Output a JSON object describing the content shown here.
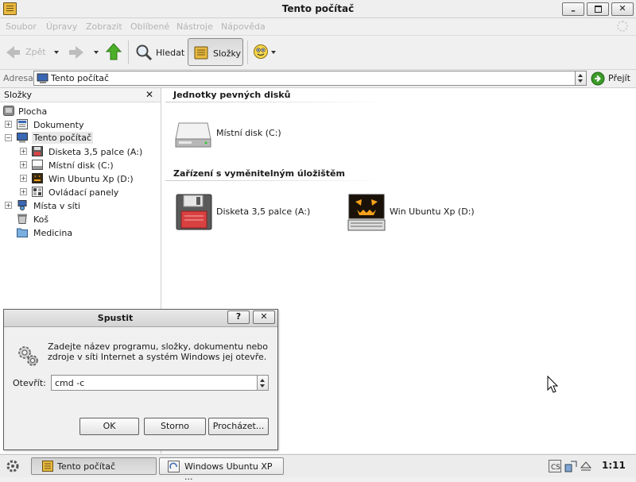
{
  "window": {
    "title": "Tento počítač"
  },
  "menu": {
    "items": [
      "Soubor",
      "Úpravy",
      "Zobrazit",
      "Oblíbené",
      "Nástroje",
      "Nápověda"
    ]
  },
  "toolbar": {
    "back_label": "Zpět",
    "search_label": "Hledat",
    "folders_label": "Složky"
  },
  "address": {
    "label": "Adresa",
    "value": "Tento počítač",
    "go_label": "Přejít"
  },
  "folders_pane": {
    "title": "Složky",
    "close_glyph": "✕",
    "items": [
      {
        "label": "Plocha",
        "icon": "desktop-icon"
      },
      {
        "label": "Dokumenty",
        "icon": "documents-icon"
      },
      {
        "label": "Tento počítač",
        "icon": "computer-icon"
      },
      {
        "label": "Disketa 3,5 palce (A:)",
        "icon": "floppy-icon"
      },
      {
        "label": "Místní disk (C:)",
        "icon": "harddisk-icon"
      },
      {
        "label": "Win Ubuntu Xp (D:)",
        "icon": "cd-drive-icon"
      },
      {
        "label": "Ovládací panely",
        "icon": "control-panel-icon"
      },
      {
        "label": "Místa v síti",
        "icon": "network-icon"
      },
      {
        "label": "Koš",
        "icon": "recycle-bin-icon"
      },
      {
        "label": "Medicina",
        "icon": "folder-icon"
      }
    ]
  },
  "content": {
    "groups": [
      {
        "title": "Jednotky pevných disků",
        "items": [
          {
            "label": "Místní disk (C:)",
            "icon": "harddisk-icon"
          }
        ]
      },
      {
        "title": "Zařízení s vyměnitelným úložištěm",
        "items": [
          {
            "label": "Disketa 3,5 palce (A:)",
            "icon": "floppy-icon"
          },
          {
            "label": "Win Ubuntu Xp (D:)",
            "icon": "cd-drive-icon"
          }
        ]
      }
    ]
  },
  "run_dialog": {
    "title": "Spustit",
    "help_glyph": "?",
    "close_glyph": "✕",
    "description_line1": "Zadejte název programu, složky, dokumentu nebo",
    "description_line2": "zdroje v síti Internet a systém Windows jej otevře.",
    "open_label": "Otevřít:",
    "input_value": "cmd -c",
    "ok_label": "OK",
    "cancel_label": "Storno",
    "browse_label": "Procházet..."
  },
  "taskbar": {
    "tasks": [
      {
        "label": "Tento počítač",
        "icon": "folder-window-icon",
        "active": true
      },
      {
        "label": "Windows Ubuntu XP ...",
        "icon": "browser-window-icon",
        "active": false
      }
    ],
    "clock": "1:11",
    "tray": [
      "keyboard-layout-icon",
      "network-tray-icon",
      "eject-icon"
    ]
  },
  "colors": {
    "selection": "#e8e8e8",
    "go_green": "#3c9b2a",
    "up_green": "#4caf2a"
  }
}
